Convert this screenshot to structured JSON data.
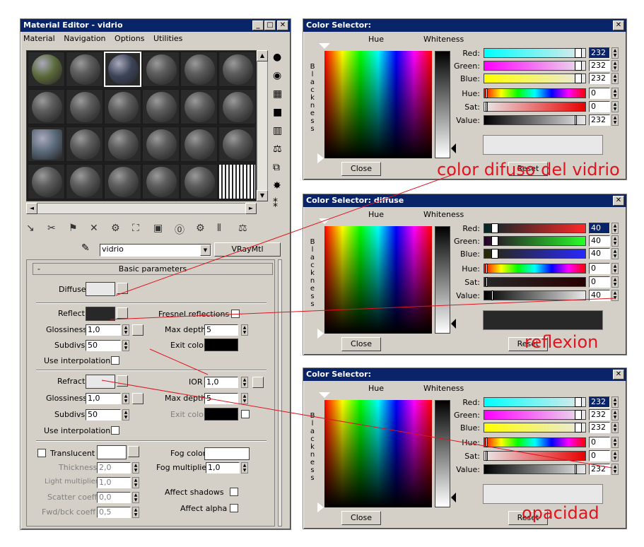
{
  "material_editor": {
    "title": "Material Editor - vidrio",
    "menu": [
      "Material",
      "Navigation",
      "Options",
      "Utilities"
    ],
    "material_name": "vidrio",
    "material_type": "VRayMtl",
    "rollout_title": "Basic parameters",
    "diffuse_label": "Diffuse",
    "reflect_label": "Reflect",
    "fresnel_label": "Fresnel reflections",
    "refl_glossiness_label": "Glossiness",
    "refl_glossiness": "1,0",
    "max_depth_label": "Max depth",
    "refl_max_depth": "5",
    "subdivs_label": "Subdivs",
    "refl_subdivs": "50",
    "exit_color_label": "Exit color",
    "use_interp_label": "Use interpolation",
    "refract_label": "Refract",
    "ior_label": "IOR",
    "ior_value": "1,0",
    "refr_glossiness": "1,0",
    "refr_max_depth": "5",
    "refr_subdivs": "50",
    "translucent_label": "Translucent",
    "fog_color_label": "Fog color",
    "thickness_label": "Thickness",
    "thickness": "2,0",
    "fog_mult_label": "Fog multiplier",
    "fog_mult": "1,0",
    "light_mult_label": "Light multiplier",
    "light_mult": "1,0",
    "scatter_label": "Scatter coeff",
    "scatter": "0,0",
    "fwdbck_label": "Fwd/bck coeff",
    "fwdbck": "0,5",
    "affect_shadows_label": "Affect shadows",
    "affect_alpha_label": "Affect alpha",
    "minimize": "_",
    "restore": "□",
    "close": "✕",
    "rollout_toggle": "-",
    "dropdown_arrow": "▼",
    "scroll_up": "▲",
    "scroll_down": "▼",
    "scroll_left": "◄",
    "scroll_right": "►",
    "spin_up": "▲",
    "spin_down": "▼",
    "pick_icon": "✎",
    "toolbar_icons": [
      "get-material-icon",
      "put-to-scene-icon",
      "assign-icon",
      "delete-icon",
      "make-unique-icon",
      "put-to-library-icon",
      "material-id-icon",
      "show-map-icon",
      "show-end-icon",
      "go-to-parent-icon",
      "go-forward-icon"
    ],
    "toolbar_glyphs": [
      "↘",
      "✂",
      "⚑",
      "✕",
      "⚙",
      "⛶",
      "▣",
      "⓪",
      "⚙",
      "⫴",
      "⚖"
    ],
    "side_glyphs": [
      "●",
      "◉",
      "▦",
      "■",
      "▥",
      "⚖",
      "⧉",
      "✸",
      "⁑"
    ]
  },
  "color_selectors": [
    {
      "title": "Color Selector:",
      "hue_label": "Hue",
      "whiteness_label": "Whiteness",
      "blackness_letters": [
        "B",
        "l",
        "a",
        "c",
        "k",
        "n",
        "e",
        "s",
        "s"
      ],
      "red_label": "Red:",
      "green_label": "Green:",
      "blue_label": "Blue:",
      "hue2_label": "Hue:",
      "sat_label": "Sat:",
      "value_label": "Value:",
      "red": "232",
      "green": "232",
      "blue": "232",
      "hue": "0",
      "sat": "0",
      "value": "232",
      "close_label": "Close",
      "reset_label": "Reset",
      "preview_color": "#e8e8e8",
      "annotation": "color difuso del vidrio"
    },
    {
      "title": "Color Selector: diffuse",
      "hue_label": "Hue",
      "whiteness_label": "Whiteness",
      "blackness_letters": [
        "B",
        "l",
        "a",
        "c",
        "k",
        "n",
        "e",
        "s",
        "s"
      ],
      "red_label": "Red:",
      "green_label": "Green:",
      "blue_label": "Blue:",
      "hue2_label": "Hue:",
      "sat_label": "Sat:",
      "value_label": "Value:",
      "red": "40",
      "green": "40",
      "blue": "40",
      "hue": "0",
      "sat": "0",
      "value": "40",
      "close_label": "Close",
      "reset_label": "Reset",
      "preview_color": "#282828",
      "annotation": "reflexion"
    },
    {
      "title": "Color Selector:",
      "hue_label": "Hue",
      "whiteness_label": "Whiteness",
      "blackness_letters": [
        "B",
        "l",
        "a",
        "c",
        "k",
        "n",
        "e",
        "s",
        "s"
      ],
      "red_label": "Red:",
      "green_label": "Green:",
      "blue_label": "Blue:",
      "hue2_label": "Hue:",
      "sat_label": "Sat:",
      "value_label": "Value:",
      "red": "232",
      "green": "232",
      "blue": "232",
      "hue": "0",
      "sat": "0",
      "value": "232",
      "close_label": "Close",
      "reset_label": "Reset",
      "preview_color": "#e8e8e8",
      "annotation": "opacidad"
    }
  ],
  "colors": {
    "titlebar": "#0a246a",
    "annotation": "#e0141e",
    "diffuse_swatch": "#e8e8e8",
    "reflect_swatch": "#282828",
    "refract_swatch": "#e8e8e8",
    "fog_swatch": "#ffffff",
    "exit_swatch": "#000000"
  }
}
